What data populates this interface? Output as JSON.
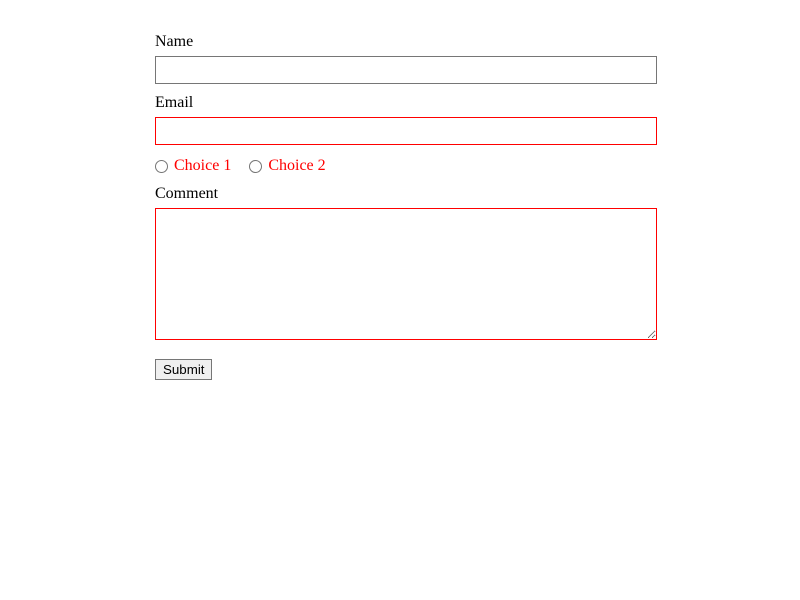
{
  "form": {
    "name": {
      "label": "Name",
      "value": "",
      "invalid": false
    },
    "email": {
      "label": "Email",
      "value": "",
      "invalid": true
    },
    "choices": {
      "invalid": true,
      "options": [
        {
          "label": "Choice 1",
          "checked": false
        },
        {
          "label": "Choice 2",
          "checked": false
        }
      ]
    },
    "comment": {
      "label": "Comment",
      "value": "",
      "invalid": true
    },
    "submit_label": "Submit"
  },
  "colors": {
    "error": "#ff0000",
    "border_default": "#767676"
  }
}
